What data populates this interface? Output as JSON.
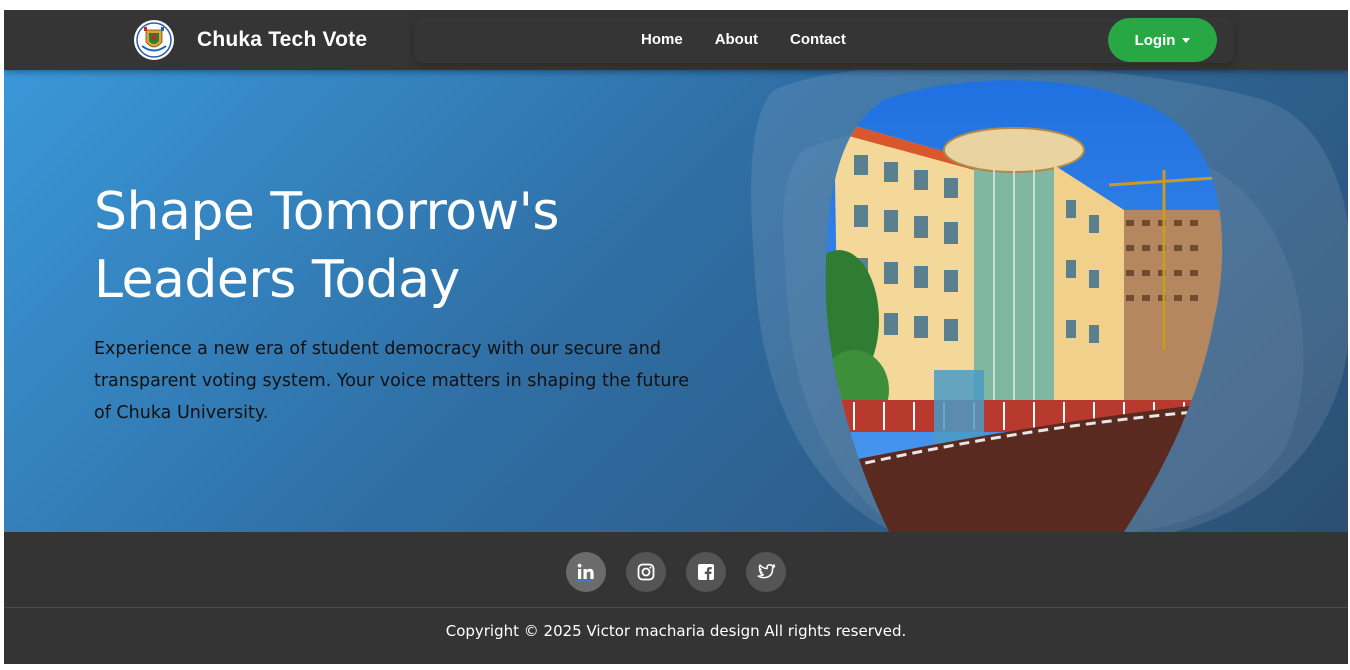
{
  "nav": {
    "brand": "Chuka Tech Vote",
    "logo_icon": "university-crest-icon",
    "links": [
      "Home",
      "About",
      "Contact"
    ],
    "login_label": "Login"
  },
  "hero": {
    "title": "Shape Tomorrow's Leaders Today",
    "subtitle": "Experience a new era of student democracy with our secure and transparent voting system. Your voice matters in shaping the future of Chuka University.",
    "image_subject": "campus-building-photo"
  },
  "footer": {
    "socials": [
      {
        "icon": "linkedin-icon"
      },
      {
        "icon": "instagram-icon"
      },
      {
        "icon": "facebook-icon"
      },
      {
        "icon": "twitter-icon"
      }
    ],
    "copyright": "Copyright © 2025 Victor macharia design All rights reserved."
  },
  "colors": {
    "nav_bg": "#353535",
    "login_green": "#28a745",
    "hero_gradient_start": "#3a97d8",
    "hero_gradient_end": "#2c4f72",
    "footer_bg": "#343434"
  }
}
